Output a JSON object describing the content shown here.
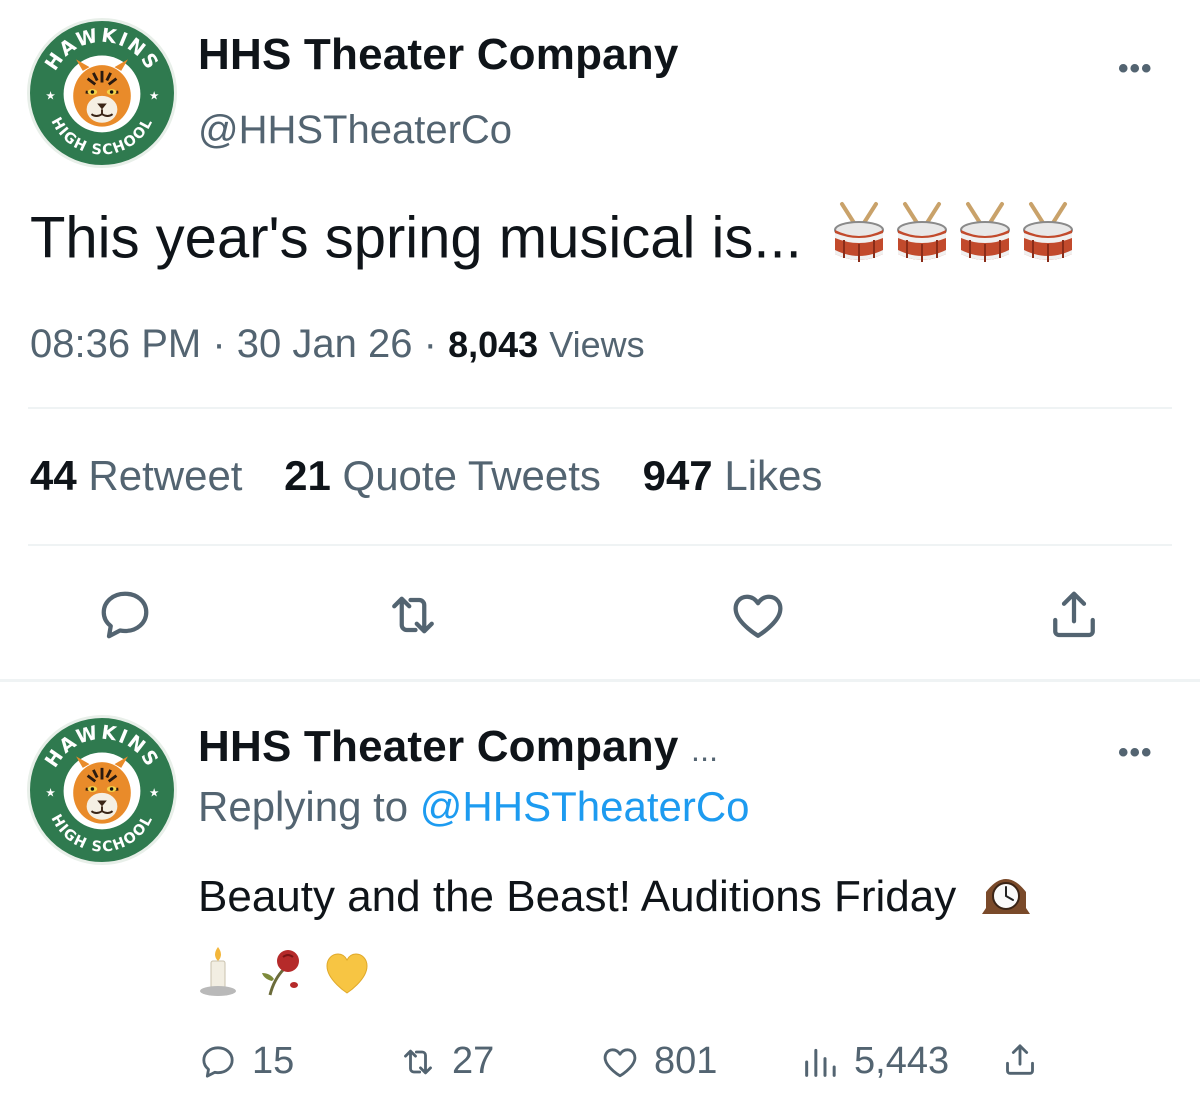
{
  "tweet": {
    "author_name": "HHS Theater Company",
    "author_handle": "@HHSTheaterCo",
    "avatar_text_top": "HAWKINS",
    "avatar_text_bottom": "HIGH SCHOOL",
    "more_label": "•••",
    "text": "This year's spring musical is...",
    "time": "08:36 PM",
    "date": "30 Jan 26",
    "views_count": "8,043",
    "views_label": "Views",
    "separator": "·",
    "retweets_count": "44",
    "retweets_label": "Retweet",
    "quotes_count": "21",
    "quotes_label": "Quote Tweets",
    "likes_count": "947",
    "likes_label": "Likes"
  },
  "reply": {
    "author_name": "HHS Theater Company",
    "ellipsis": "...",
    "replying_prefix": "Replying to",
    "replying_handle": "@HHSTheaterCo",
    "more_label": "•••",
    "text_line1": "Beauty and the Beast! Auditions Friday",
    "replies_count": "15",
    "retweets_count": "27",
    "likes_count": "801",
    "views_count": "5,443"
  },
  "colors": {
    "accent": "#1d9bf0",
    "muted": "#536471",
    "avatar_green": "#2f7a4f"
  }
}
